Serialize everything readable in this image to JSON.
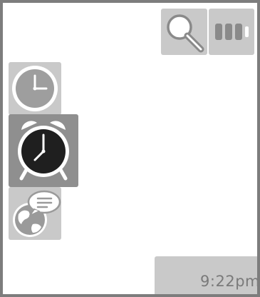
{
  "status_bar": {
    "time": "9:22pm"
  },
  "toolbar": {
    "search_icon": "magnifier-icon",
    "battery_icon": "battery-icon",
    "battery_level": 0.75
  },
  "app_dock": {
    "items": [
      {
        "icon": "clock-icon",
        "selected": false
      },
      {
        "icon": "alarm-clock-icon",
        "selected": true
      },
      {
        "icon": "globe-chat-icon",
        "selected": false
      }
    ]
  },
  "colors": {
    "frame": "#7d7d7d",
    "tile": "#c9c9c9",
    "tile_selected": "#8f8f8f",
    "icon_light": "#9a9a9a",
    "icon_dark": "#1f1f1f"
  }
}
